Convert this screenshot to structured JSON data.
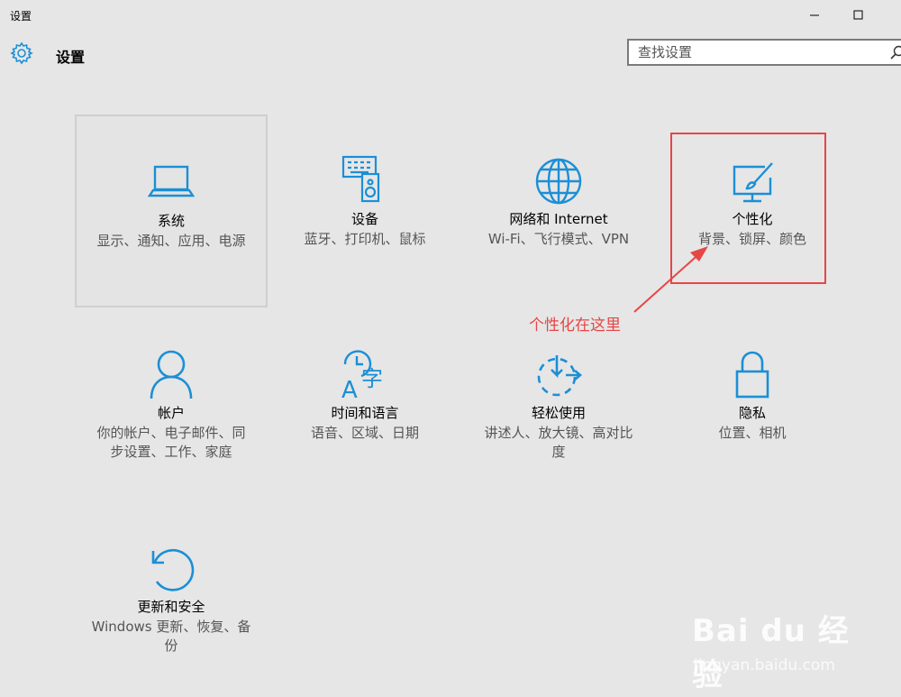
{
  "window": {
    "title": "设置"
  },
  "header": {
    "title": "设置"
  },
  "search": {
    "placeholder": "查找设置"
  },
  "tiles": [
    {
      "name": "系统",
      "desc": "显示、通知、应用、电源",
      "icon": "laptop-icon"
    },
    {
      "name": "设备",
      "desc": "蓝牙、打印机、鼠标",
      "icon": "devices-icon"
    },
    {
      "name": "网络和 Internet",
      "desc": "Wi-Fi、飞行模式、VPN",
      "icon": "globe-icon"
    },
    {
      "name": "个性化",
      "desc": "背景、锁屏、颜色",
      "icon": "personalization-icon"
    },
    {
      "name": "帐户",
      "desc": "你的帐户、电子邮件、同步设置、工作、家庭",
      "icon": "person-icon"
    },
    {
      "name": "时间和语言",
      "desc": "语音、区域、日期",
      "icon": "time-language-icon"
    },
    {
      "name": "轻松使用",
      "desc": "讲述人、放大镜、高对比度",
      "icon": "ease-of-access-icon"
    },
    {
      "name": "隐私",
      "desc": "位置、相机",
      "icon": "lock-icon"
    },
    {
      "name": "更新和安全",
      "desc": "Windows 更新、恢复、备份",
      "icon": "update-icon"
    }
  ],
  "annotation": {
    "text": "个性化在这里",
    "color": "#e84545"
  },
  "watermark": {
    "logo": "Bai du 经验",
    "url": "jingyan.baidu.com"
  },
  "colors": {
    "accent": "#1b8fd6",
    "background": "#e6e6e6",
    "annotation": "#e84545"
  }
}
